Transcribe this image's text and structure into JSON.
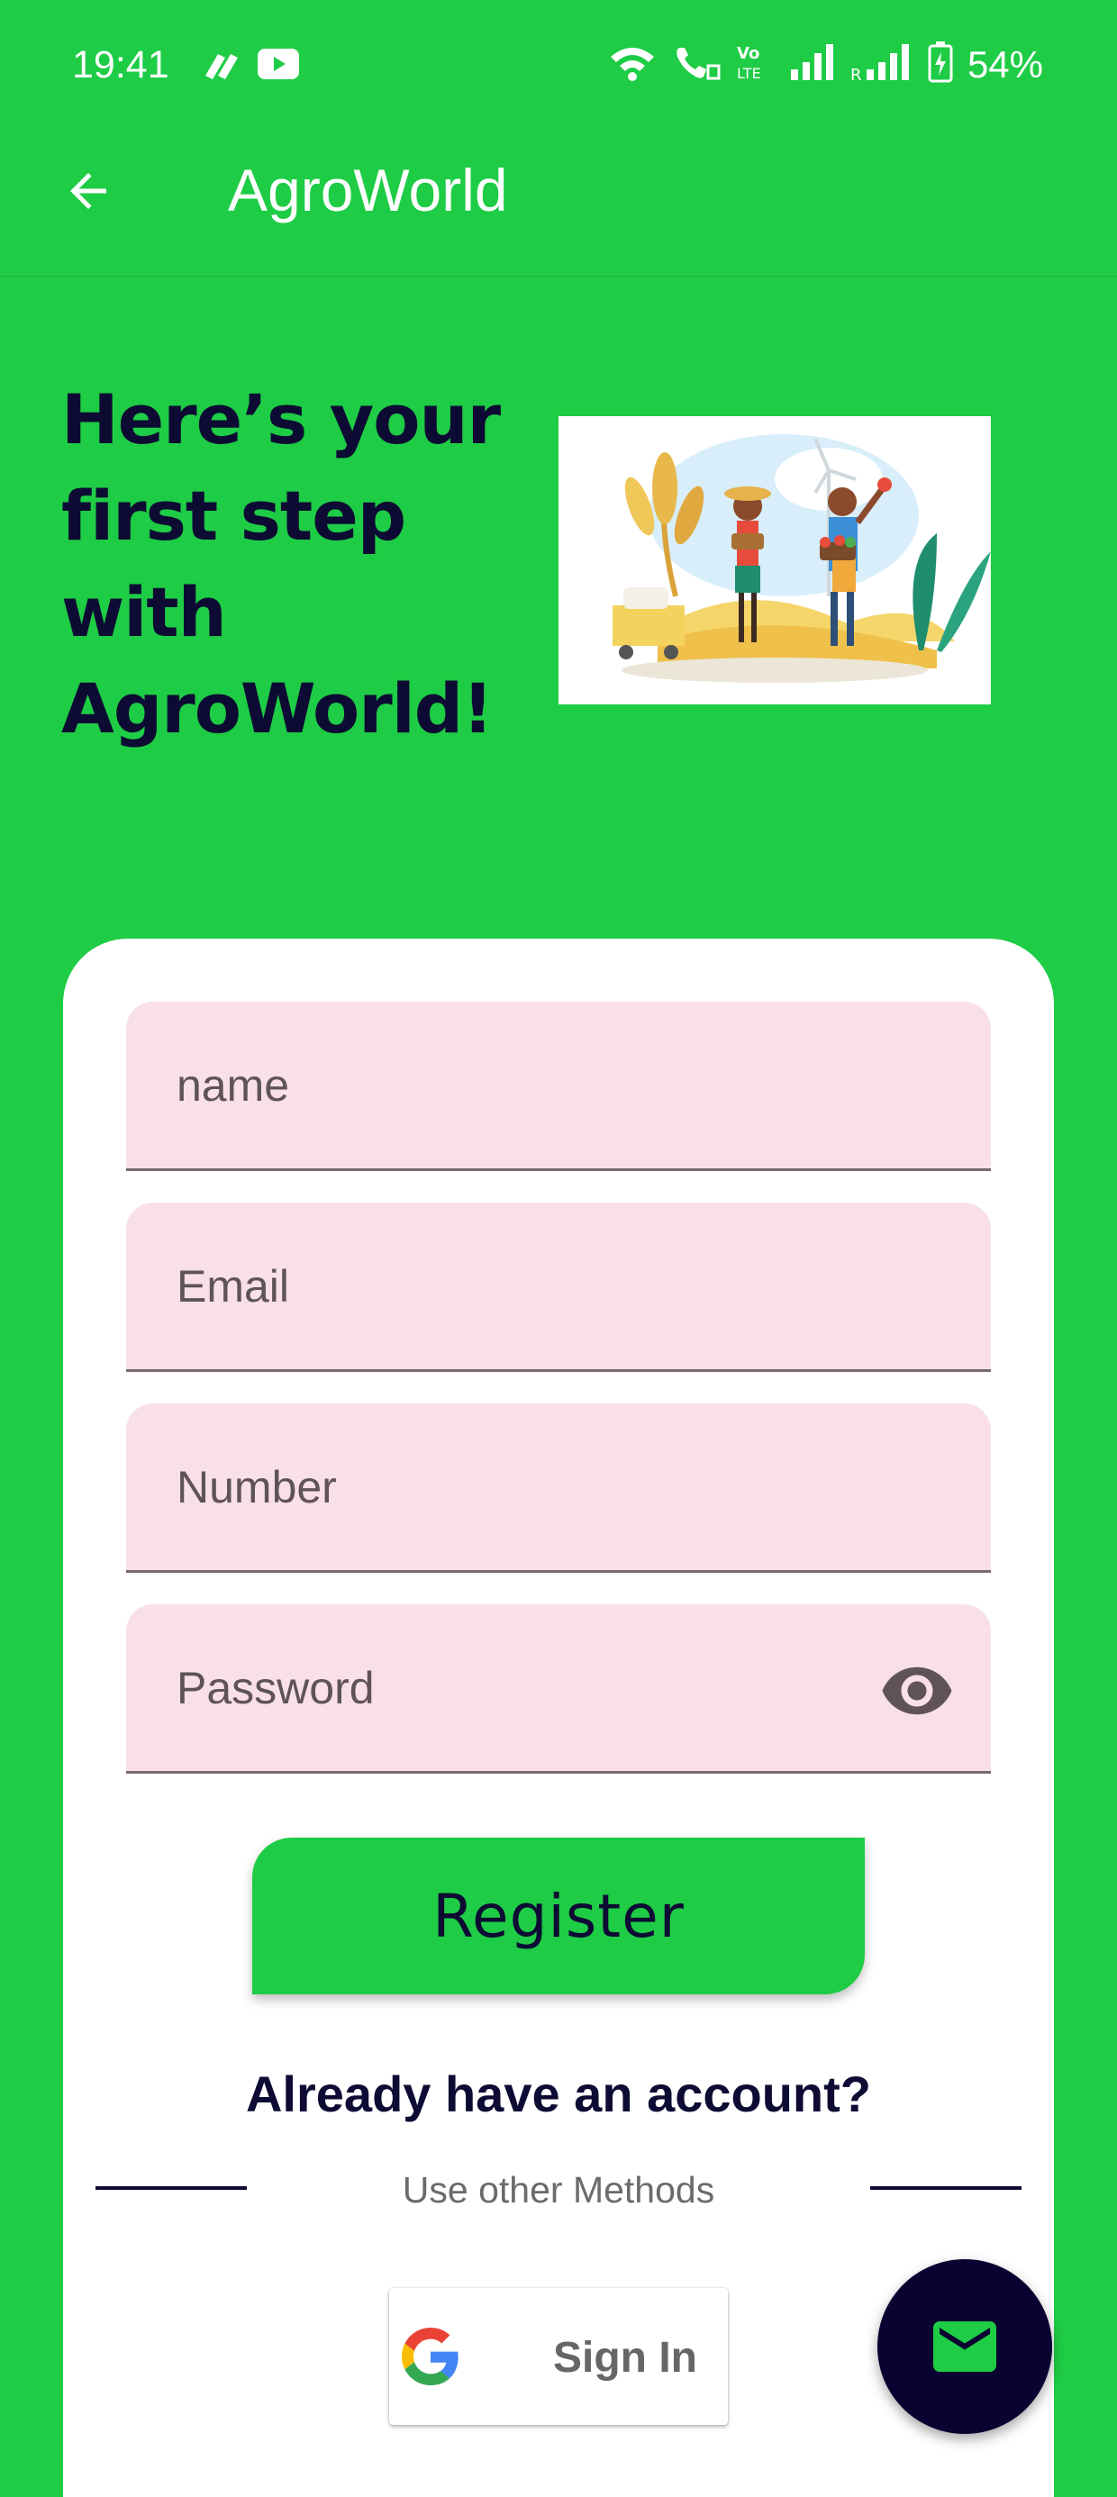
{
  "status_bar": {
    "time": "19:41",
    "battery": "54%",
    "icons": [
      "app-notification-icon",
      "youtube-icon",
      "wifi-icon",
      "wifi-calling-icon",
      "volte-icon",
      "signal-icon",
      "signal-roaming-icon",
      "battery-charging-icon"
    ]
  },
  "app_bar": {
    "title": "AgroWorld",
    "back_icon": "arrow-back-icon"
  },
  "hero": {
    "heading": "Here’s your first step with AgroWorld!",
    "image": "farmers-illustration"
  },
  "form": {
    "name_placeholder": "name",
    "email_placeholder": "Email",
    "number_placeholder": "Number",
    "password_placeholder": "Password",
    "password_toggle_icon": "eye-icon",
    "register_label": "Register",
    "already_account": "Already have an account?",
    "other_methods": "Use other Methods",
    "google_signin_label": "Sign In"
  },
  "fab": {
    "icon": "mail-icon"
  },
  "colors": {
    "background": "#1ECC45",
    "primary_dark": "#0D0B33",
    "field_bg": "#F8E0E6",
    "fab_bg": "#0A0230"
  }
}
